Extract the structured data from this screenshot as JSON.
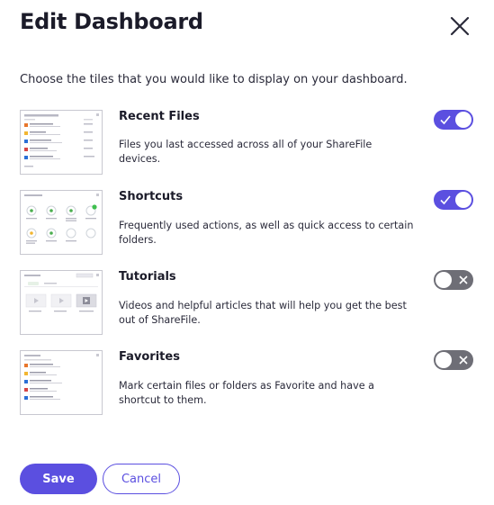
{
  "dialog": {
    "title": "Edit Dashboard",
    "intro": "Choose the tiles that you would like to display on your dashboard."
  },
  "tiles": [
    {
      "title": "Recent Files",
      "description": "Files you last accessed across all of your ShareFile devices.",
      "enabled": true,
      "thumbnail_icon": "recent-files-preview-icon"
    },
    {
      "title": "Shortcuts",
      "description": "Frequently used actions, as well as quick access to certain folders.",
      "enabled": true,
      "thumbnail_icon": "shortcuts-preview-icon"
    },
    {
      "title": "Tutorials",
      "description": "Videos and helpful articles that will help you get the best out of ShareFile.",
      "enabled": false,
      "thumbnail_icon": "tutorials-preview-icon"
    },
    {
      "title": "Favorites",
      "description": "Mark certain files or folders as Favorite and have a shortcut to them.",
      "enabled": false,
      "thumbnail_icon": "favorites-preview-icon"
    }
  ],
  "actions": {
    "save_label": "Save",
    "cancel_label": "Cancel"
  },
  "colors": {
    "accent": "#5b4fe0",
    "toggle_off": "#6e6e76"
  },
  "icons": {
    "close": "close-icon",
    "toggle_on_mark": "check-icon",
    "toggle_off_mark": "x-icon"
  }
}
